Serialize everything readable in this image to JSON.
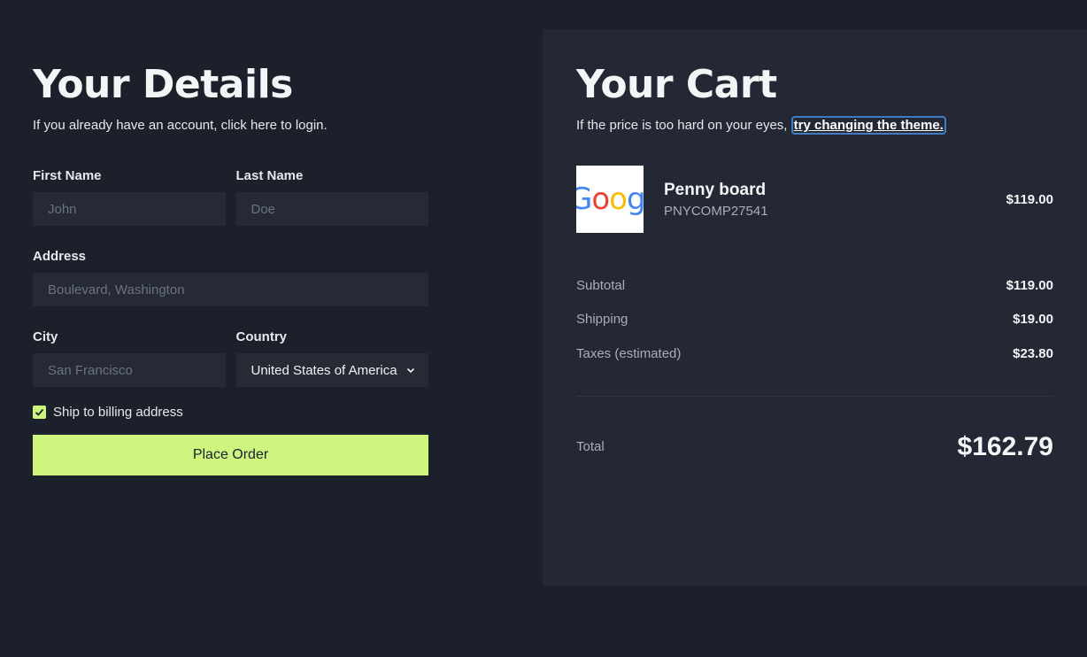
{
  "details": {
    "title": "Your Details",
    "subtitle": "If you already have an account, click here to login.",
    "first_name": {
      "label": "First Name",
      "placeholder": "John"
    },
    "last_name": {
      "label": "Last Name",
      "placeholder": "Doe"
    },
    "address": {
      "label": "Address",
      "placeholder": "Boulevard, Washington"
    },
    "city": {
      "label": "City",
      "placeholder": "San Francisco"
    },
    "country": {
      "label": "Country",
      "selected": "United States of America"
    },
    "ship_to_billing": {
      "label": "Ship to billing address",
      "checked": true
    },
    "place_order_label": "Place Order"
  },
  "cart": {
    "title": "Your Cart",
    "subtitle_text": "If the price is too hard on your eyes, ",
    "theme_link": "try changing the theme.",
    "items": [
      {
        "name": "Penny board",
        "sku": "PNYCOMP27541",
        "price": "$119.00",
        "thumb_text": "Googl"
      }
    ],
    "subtotal": {
      "label": "Subtotal",
      "value": "$119.00"
    },
    "shipping": {
      "label": "Shipping",
      "value": "$19.00"
    },
    "taxes": {
      "label": "Taxes (estimated)",
      "value": "$23.80"
    },
    "total": {
      "label": "Total",
      "value": "$162.79"
    }
  },
  "colors": {
    "background": "#1b202b",
    "panel": "#232834",
    "input": "#252a35",
    "accent": "#cef57e",
    "focus_ring": "#3f7cc4"
  }
}
